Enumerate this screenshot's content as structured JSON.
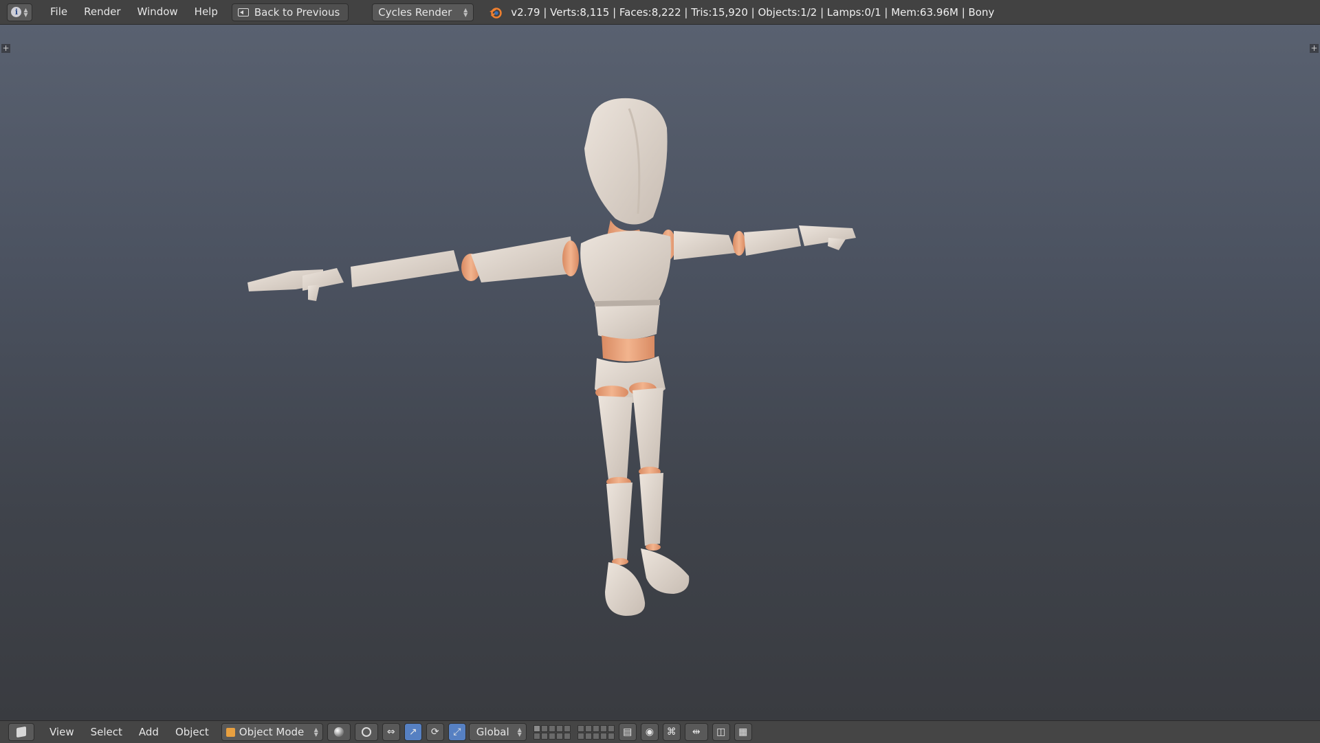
{
  "top_header": {
    "editor_type_icon": "info-icon",
    "editor_type_glyph": "i",
    "menu": [
      "File",
      "Render",
      "Window",
      "Help"
    ],
    "back_button": "Back to Previous",
    "render_engine": "Cycles Render",
    "stats": "v2.79 | Verts:8,115 | Faces:8,222 | Tris:15,920 | Objects:1/2 | Lamps:0/1 | Mem:63.96M | Bony"
  },
  "viewport": {
    "left_toggle": "+",
    "right_toggle": "+",
    "model_color": "#d8cfc7",
    "joint_color": "#e8a27a"
  },
  "bottom_header": {
    "menu": [
      "View",
      "Select",
      "Add",
      "Object"
    ],
    "mode": "Object Mode",
    "orientation": "Global"
  }
}
